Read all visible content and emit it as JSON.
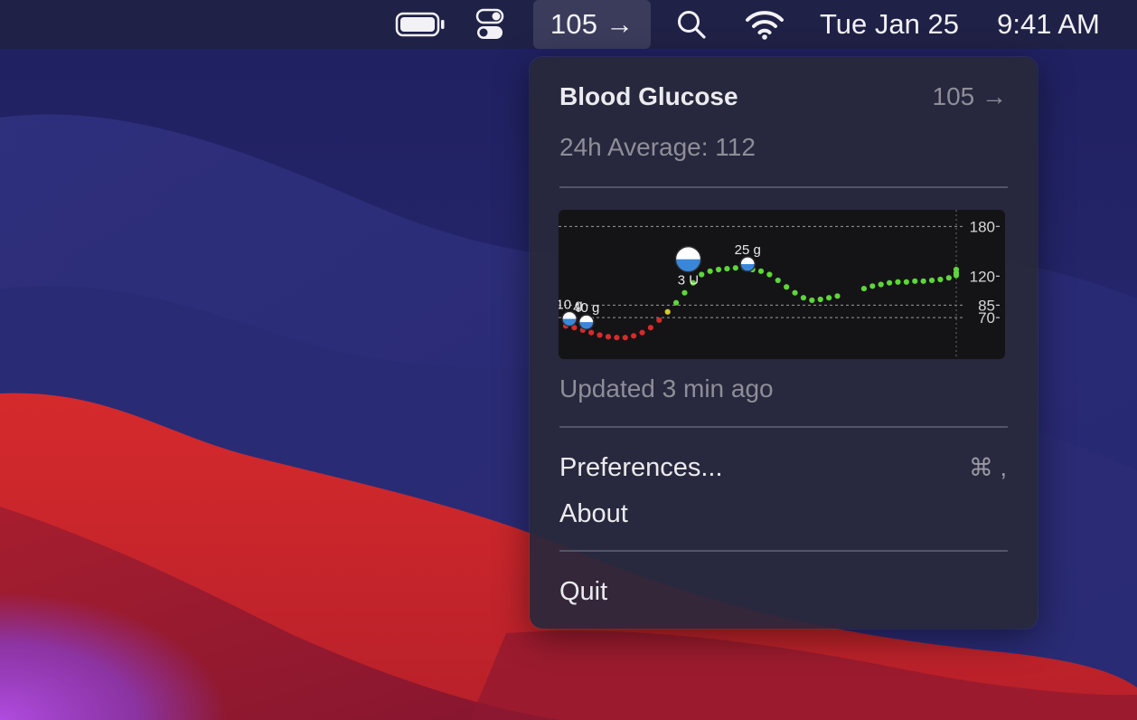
{
  "menubar": {
    "glucose_label": "105 →",
    "date": "Tue Jan 25",
    "time": "9:41 AM",
    "icons": [
      "battery-icon",
      "control-center-icon",
      "search-icon",
      "wifi-icon"
    ]
  },
  "menu": {
    "title": "Blood Glucose",
    "current_value": "105 →",
    "average": "24h Average: 112",
    "updated": "Updated 3 min ago",
    "items": [
      {
        "label": "Preferences...",
        "shortcut": "⌘ ,"
      },
      {
        "label": "About",
        "shortcut": ""
      },
      {
        "label": "Quit",
        "shortcut": ""
      }
    ]
  },
  "chart_data": {
    "type": "scatter",
    "y_ticks": [
      "180",
      "120",
      "85",
      "70"
    ],
    "ylim": [
      20,
      200
    ],
    "reference_lines": [
      180,
      85,
      70
    ],
    "series": [
      {
        "values": [
          60,
          58,
          55,
          52,
          49,
          47,
          46,
          46,
          48,
          52,
          58,
          67,
          77,
          88,
          100,
          112,
          122,
          126,
          128,
          129,
          130,
          130,
          128,
          126,
          122,
          115,
          107,
          100,
          94,
          91,
          92,
          94,
          96,
          105,
          108,
          110,
          112,
          113,
          113,
          114,
          114,
          115,
          116,
          118,
          121,
          124,
          128
        ],
        "colors": [
          "#d42c2c",
          "#d42c2c",
          "#d42c2c",
          "#d42c2c",
          "#d42c2c",
          "#d42c2c",
          "#d42c2c",
          "#d42c2c",
          "#d42c2c",
          "#d42c2c",
          "#d42c2c",
          "#d42c2c",
          "#d4c82c",
          "#5ed63a",
          "#5ed63a",
          "#5ed63a",
          "#5ed63a",
          "#5ed63a",
          "#5ed63a",
          "#5ed63a",
          "#5ed63a",
          "#5ed63a",
          "#5ed63a",
          "#5ed63a",
          "#5ed63a",
          "#5ed63a",
          "#5ed63a",
          "#5ed63a",
          "#5ed63a",
          "#5ed63a",
          "#5ed63a",
          "#5ed63a",
          "#5ed63a",
          "#5ed63a",
          "#5ed63a",
          "#5ed63a",
          "#5ed63a",
          "#5ed63a",
          "#5ed63a",
          "#5ed63a",
          "#5ed63a",
          "#5ed63a",
          "#5ed63a",
          "#5ed63a",
          "#5ed63a",
          "#5ed63a",
          "#5ed63a"
        ]
      }
    ],
    "annotations": [
      {
        "label": "10 g",
        "kind": "carbs",
        "fill": 0.3,
        "value": 62,
        "index": 0
      },
      {
        "label": "40 g",
        "kind": "carbs",
        "fill": 0.3,
        "value": 58,
        "index": 2
      },
      {
        "label": "3 U",
        "kind": "insulin",
        "fill": 0.5,
        "value": 112,
        "index": 14
      },
      {
        "label": "25 g",
        "kind": "carbs",
        "fill": 0.3,
        "value": 128,
        "index": 21
      }
    ]
  }
}
